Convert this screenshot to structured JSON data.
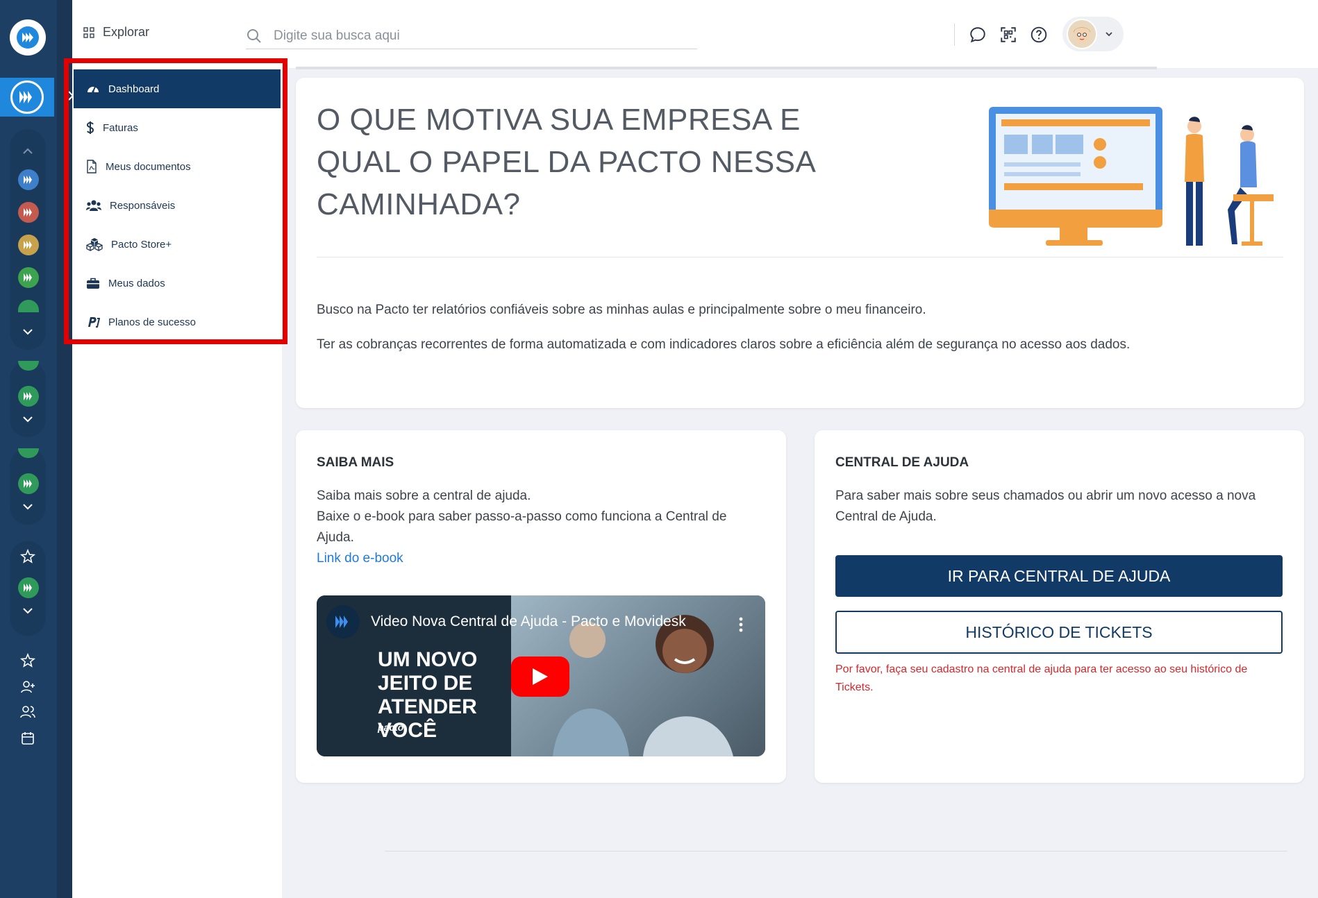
{
  "topbar": {
    "explore_label": "Explorar",
    "search_placeholder": "Digite sua busca aqui"
  },
  "menu": {
    "items": [
      {
        "label": "Dashboard",
        "icon": "dashboard-icon",
        "active": true
      },
      {
        "label": "Faturas",
        "icon": "dollar-icon"
      },
      {
        "label": "Meus documentos",
        "icon": "pdf-document-icon"
      },
      {
        "label": "Responsáveis",
        "icon": "users-icon"
      },
      {
        "label": "Pacto Store+",
        "icon": "cubes-icon"
      },
      {
        "label": "Meus dados",
        "icon": "briefcase-icon"
      },
      {
        "label": "Planos de sucesso",
        "icon": "pacto-logo-icon"
      }
    ]
  },
  "hero": {
    "title": "O que motiva sua empresa e qual o papel da Pacto nessa caminhada?",
    "paragraph_1": "Busco na Pacto ter relatórios confiáveis sobre as minhas aulas e principalmente sobre o meu financeiro.",
    "paragraph_2": "Ter as cobranças recorrentes de forma automatizada e com indicadores claros sobre a eficiência além de segurança no acesso aos dados."
  },
  "saiba_mais": {
    "title": "SAIBA MAIS",
    "line_1": "Saiba mais sobre a central de ajuda.",
    "line_2": "Baixe o e-book para saber passo-a-passo como funciona a Central de Ajuda.",
    "link": "Link do e-book",
    "video": {
      "title": "Video Nova Central de Ajuda - Pacto e Movidesk",
      "kicker": "UM NOVO JEITO DE ATENDER VOCÊ",
      "brand": "pacto"
    }
  },
  "central": {
    "title": "CENTRAL DE AJUDA",
    "text": "Para saber mais sobre seus chamados ou abrir um novo acesso a nova Central de Ajuda.",
    "primary_button": "IR PARA CENTRAL DE AJUDA",
    "secondary_button": "HISTÓRICO DE TICKETS",
    "warning": "Por favor, faça seu cadastro na central de ajuda para ter acesso ao seu histórico de Tickets."
  },
  "colors": {
    "rail": "#1d3f63",
    "active_menu": "#123a66",
    "highlight_border": "#e40000",
    "link": "#1f7adb",
    "error": "#d8262a"
  }
}
